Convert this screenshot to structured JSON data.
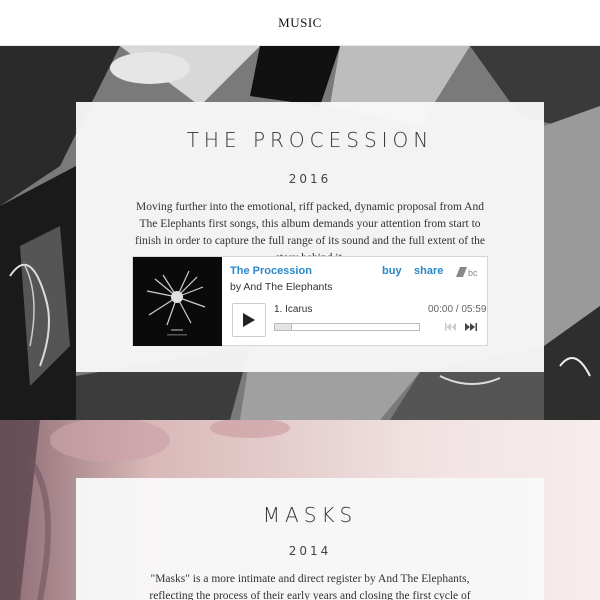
{
  "header": {
    "title": "MUSIC"
  },
  "albums": [
    {
      "title": "THE PROCESSION",
      "year": "2016",
      "description": "Moving further into the emotional, riff packed, dynamic proposal from And The Elephants first songs, this album demands your attention from start to finish in order to capture the full range of its sound and the full extent of the story behind it.",
      "player": {
        "album": "The Procession",
        "artist": "by And The Elephants",
        "buy_label": "buy",
        "share_label": "share",
        "track": "1. Icarus",
        "time": "00:00 / 05:59",
        "progress": 0,
        "accent_color": "#2a88c8"
      }
    },
    {
      "title": "MASKS",
      "year": "2014",
      "description": "\"Masks\" is a more intimate and direct register by And The Elephants, reflecting the process of their early years and closing the first cycle of composition by the band."
    }
  ]
}
